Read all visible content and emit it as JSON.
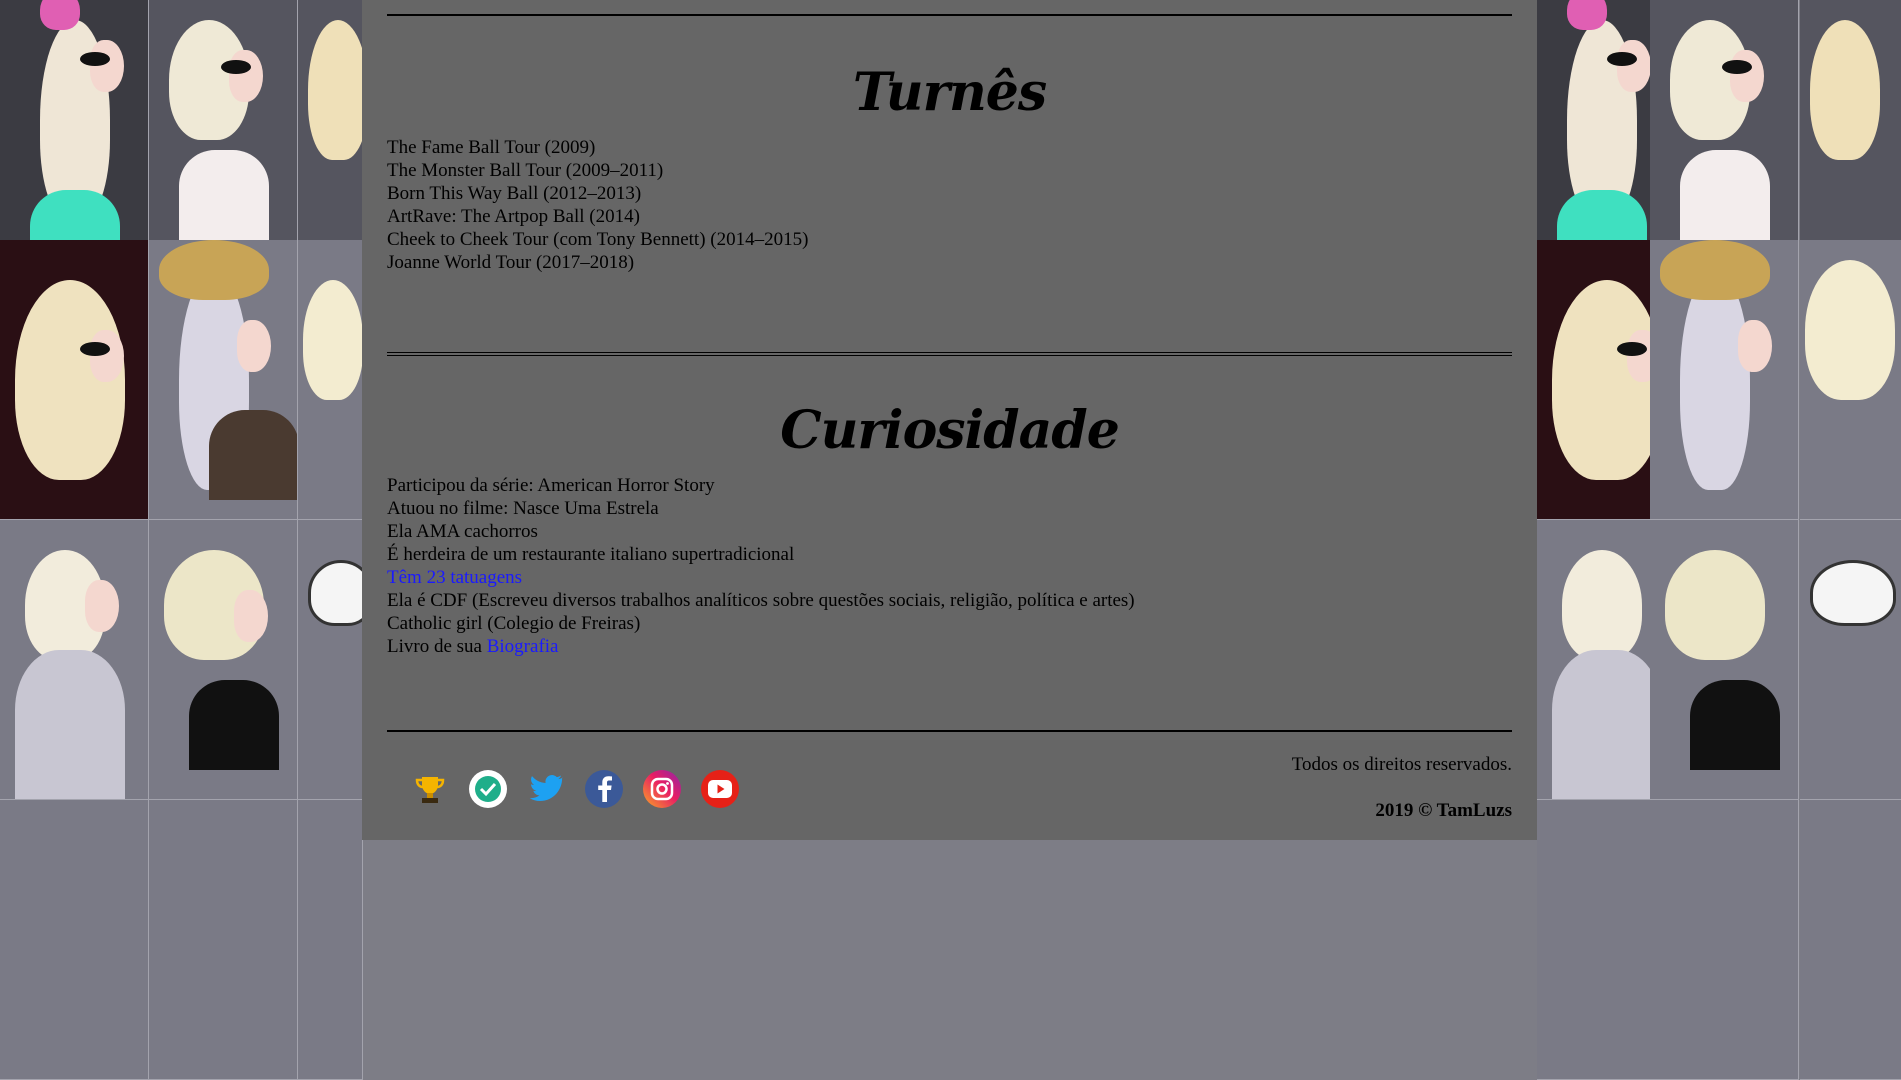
{
  "sections": {
    "tours": {
      "title": "Turnês",
      "items": [
        "The Fame Ball Tour (2009)",
        "The Monster Ball Tour (2009–2011)",
        "Born This Way Ball (2012–2013)",
        "ArtRave: The Artpop Ball (2014)",
        "Cheek to Cheek Tour (com Tony Bennett) (2014–2015)",
        "Joanne World Tour (2017–2018)"
      ]
    },
    "trivia": {
      "title": "Curiosidade",
      "items": [
        "Participou da série: American Horror Story",
        "Atuou no filme: Nasce Uma Estrela",
        "Ela AMA cachorros",
        "É herdeira de um restaurante italiano supertradicional"
      ],
      "tattoo_link": "Têm 23 tatuagens",
      "items_after": [
        "Ela é CDF (Escreveu diversos trabalhos analíticos sobre questões sociais, religião, política e artes)",
        "Catholic girl (Colegio de Freiras)"
      ],
      "book_prefix": "Livro de sua",
      "book_link": "Biografia"
    }
  },
  "footer": {
    "rights": "Todos os direitos reservados.",
    "copyright": "2019 © TamLuzs",
    "icons": [
      "trophy-icon",
      "verified-check-icon",
      "twitter-icon",
      "facebook-icon",
      "instagram-icon",
      "youtube-icon"
    ]
  },
  "colors": {
    "panel": "#666666",
    "link": "#1a1aff",
    "twitter": "#1da1f2",
    "facebook": "#3b5998",
    "youtube": "#e62117"
  }
}
